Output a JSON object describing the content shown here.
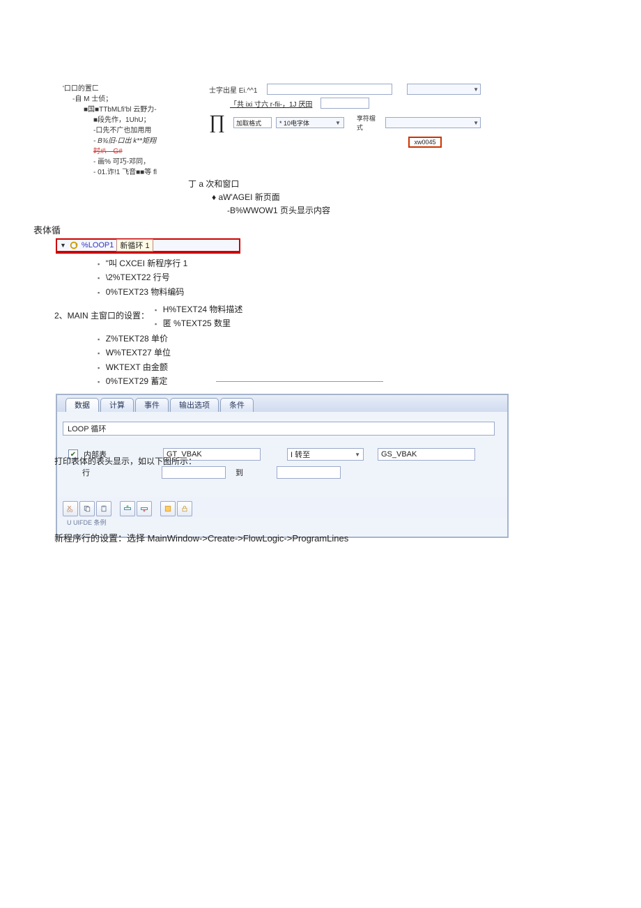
{
  "top_left": {
    "l1": "'口口的置匚",
    "l2": "-自 M 士侦；",
    "l3": "■国■TTbMLfi'bl 云野力-",
    "l4": "■段先作，1UhU；",
    "l5": "-口先不广也加用用",
    "l6": "- B¾旧-口出 k**矩翔",
    "l7": "时#\\—G#",
    "l8": "- 画% 可巧-邓同，",
    "l9": "- 01.诈!1 飞音■■等 fl"
  },
  "top_right": {
    "label_top": "士字出星 Ei.^^1",
    "row2": "「共 ixi 寸六 r-fii-，1J 厌田",
    "panel_left_label": "加取格式",
    "font_value": "* 10电字体",
    "panel_right_label": "享符檔式",
    "red_btn": "xw0045"
  },
  "mid_tree": {
    "l1": "丁 a 次和窗口",
    "l2": "aW'AGEI 新页面",
    "l3": "-B%WWOW1 页头显示内容"
  },
  "heading": "表体循",
  "loopstrip": {
    "code": "%LOOP1",
    "name": "新循环 1"
  },
  "details1": [
    "\"叫 CXCEI 新程序行 1",
    "\\2%TEXT22 行号",
    "0%TEXT23 物料编码"
  ],
  "details_right": [
    "H%TEXT24 物料描述",
    "匿 %TEXT25 数里"
  ],
  "section_label": "2、MAIN 主窗口的设置：",
  "details2": [
    "Z%TEKT28 单价",
    "W%TEXT27 单位",
    "WKTEXT 由金颤",
    "0%TEXT29 蓄定"
  ],
  "sap": {
    "tabs": [
      "数据",
      "计算",
      "事件",
      "输出选项",
      "条件"
    ],
    "loop_title": "LOOP 循环",
    "check_label": "内部表",
    "row_label": "行",
    "gt_value": "GT_VBAK",
    "to_mid_label": "I 转至",
    "gs_value": "GS_VBAK",
    "to_label": "到",
    "sub_note": "U UIFDE 条例"
  },
  "overlay_text": "打印表体的表头显示，如以下图所示：",
  "bottom_text": "新程序行的设置：选择 MainWindow->Create->FlowLogic->ProgramLines"
}
